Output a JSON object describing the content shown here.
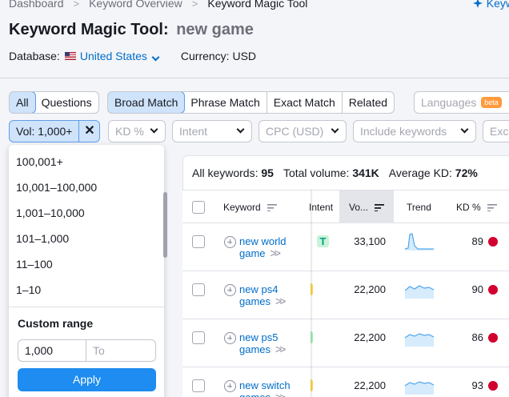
{
  "breadcrumb": [
    "Dashboard",
    "Keyword Overview",
    "Keyword Magic Tool"
  ],
  "top_right_link": "Keyw",
  "page": {
    "title": "Keyword Magic Tool:",
    "keyword": "new game"
  },
  "database": {
    "label": "Database:",
    "value": "United States"
  },
  "currency": "Currency: USD",
  "tabs_type": [
    "All",
    "Questions"
  ],
  "tabs_match": [
    "Broad Match",
    "Phrase Match",
    "Exact Match",
    "Related"
  ],
  "languages": {
    "label": "Languages",
    "badge": "beta"
  },
  "filters": {
    "volume": "Vol: 1,000+",
    "kd": "KD %",
    "intent": "Intent",
    "cpc": "CPC (USD)",
    "include": "Include keywords",
    "exclude": "Exc"
  },
  "summary": {
    "all_label": "All keywords:",
    "all_value": "95",
    "vol_label": "Total volume:",
    "vol_value": "341K",
    "kd_label": "Average KD:",
    "kd_value": "72%"
  },
  "columns": {
    "keyword": "Keyword",
    "intent": "Intent",
    "volume": "Vo...",
    "trend": "Trend",
    "kd": "KD %"
  },
  "rows": [
    {
      "keyword": [
        "new world",
        "game"
      ],
      "intent": "T",
      "volume": "33,100",
      "kd": "89"
    },
    {
      "keyword": [
        "new ps4",
        "games"
      ],
      "intent": "",
      "volume": "22,200",
      "kd": "90"
    },
    {
      "keyword": [
        "new ps5",
        "games"
      ],
      "intent": "",
      "volume": "22,200",
      "kd": "86"
    },
    {
      "keyword": [
        "new switch",
        "games"
      ],
      "intent": "",
      "volume": "22,200",
      "kd": "93"
    }
  ],
  "volume_dropdown": {
    "options": [
      "100,001+",
      "10,001–100,000",
      "1,001–10,000",
      "101–1,000",
      "11–100",
      "1–10"
    ],
    "custom_range_label": "Custom range",
    "from_value": "1,000",
    "to_placeholder": "To",
    "apply_label": "Apply"
  },
  "colors": {
    "accent": "#1e8cf0",
    "link": "#006dca",
    "kd_high": "#d1002f",
    "active_bg": "#cfe3fa"
  }
}
